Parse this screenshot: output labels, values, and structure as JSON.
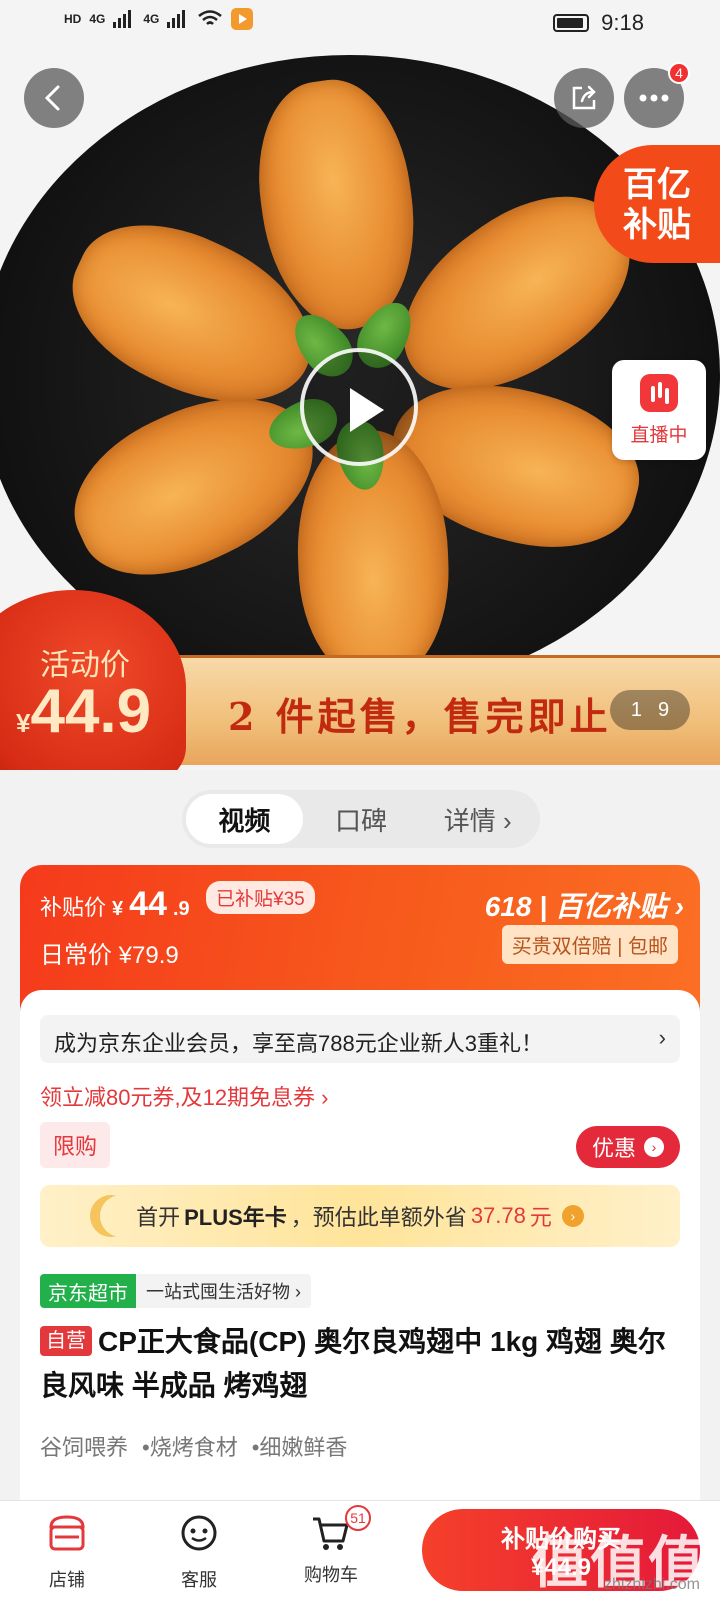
{
  "status_bar": {
    "left_indicators": [
      "HD",
      "4G",
      "4G"
    ],
    "time": "9:18"
  },
  "hero": {
    "more_badge": "4",
    "yi_badge_line1": "百亿",
    "yi_badge_line2": "补贴",
    "live_label": "直播中",
    "promo_text": "2 件起售，售完即止",
    "activity_label": "活动价",
    "activity_currency": "¥",
    "activity_price": "44.9",
    "pager_current": "1",
    "pager_total": "9"
  },
  "tabs": [
    {
      "label": "视频",
      "active": true
    },
    {
      "label": "口碑",
      "active": false
    },
    {
      "label": "详情 ›",
      "active": false
    }
  ],
  "price_card": {
    "subsidy_label": "补贴价",
    "subsidy_currency": "¥",
    "subsidy_price": "44",
    "subsidy_decimal": ".9",
    "subsidized_tag": "已补贴¥35",
    "daily_label": "日常价",
    "daily_price": "¥79.9",
    "brand_618": "618 | 百亿补贴 ›",
    "guarantee": "买贵双倍赔 | 包邮"
  },
  "content": {
    "member_text": "成为京东企业会员，享至高788元企业新人3重礼！",
    "coupon_text": "领立减80元券,及12期免息券 ›",
    "limit_tag": "限购",
    "youhui_label": "优惠",
    "plus_prefix": "首开",
    "plus_bold": "PLUS年卡",
    "plus_middle": "，预估此单额外省",
    "plus_amount": "37.78",
    "plus_suffix": "元",
    "market_tag": "京东超市",
    "market_desc": "一站式囤生活好物 ›",
    "self_tag": "自营",
    "title": "CP正大食品(CP) 奥尔良鸡翅中 1kg 鸡翅 奥尔良风味 半成品 烤鸡翅",
    "features": [
      "谷饲喂养",
      "•烧烤食材",
      "•细嫩鲜香"
    ]
  },
  "bottom_bar": {
    "store": "店铺",
    "service": "客服",
    "cart": "购物车",
    "cart_count": "51",
    "buy_label": "补贴价购买",
    "buy_price": "¥44.9"
  },
  "watermark": {
    "text": "值值值",
    "url": "zhizhizhi.com"
  },
  "colors": {
    "accent_red": "#e4393c",
    "subsidy_orange": "#f75a1c",
    "market_green": "#22b04b"
  }
}
